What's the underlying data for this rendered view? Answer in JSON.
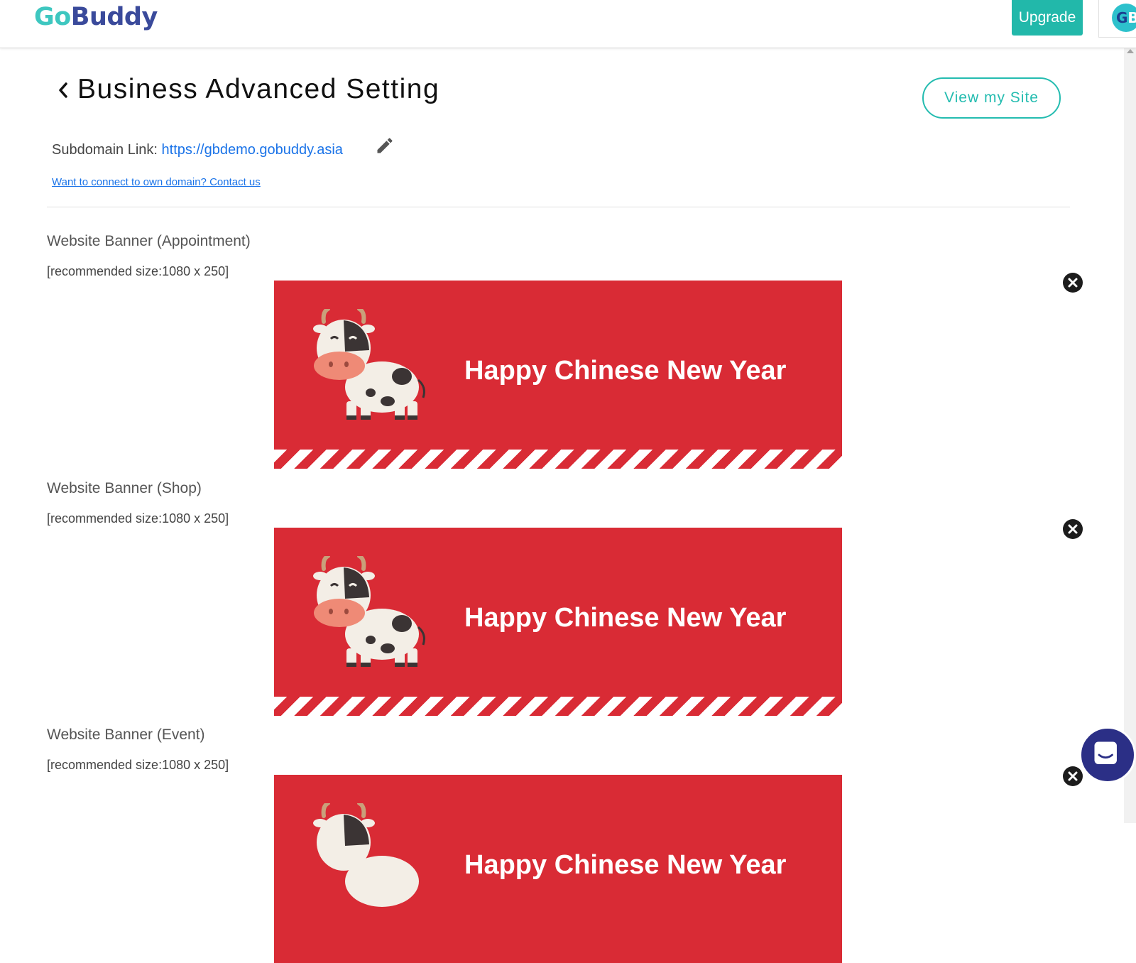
{
  "header": {
    "logo_go": "Go",
    "logo_buddy": "Buddy",
    "upgrade_label": "Upgrade",
    "avatar_initials_1": "G",
    "avatar_initials_2": "B"
  },
  "page": {
    "title": "Business Advanced Setting",
    "view_site_label": "View my Site",
    "subdomain_label": "Subdomain Link: ",
    "subdomain_url": "https://gbdemo.gobuddy.asia",
    "connect_domain_link": "Want to connect to own domain? Contact us"
  },
  "banners": [
    {
      "label": "Website Banner (Appointment)",
      "size_hint": "[recommended size:1080 x 250]",
      "banner_text": "Happy Chinese New Year"
    },
    {
      "label": "Website Banner (Shop)",
      "size_hint": "[recommended size:1080 x 250]",
      "banner_text": "Happy Chinese New Year"
    },
    {
      "label": "Website Banner (Event)",
      "size_hint": "[recommended size:1080 x 250]",
      "banner_text": "Happy Chinese New Year"
    }
  ],
  "icons": {
    "back": "chevron-left-icon",
    "edit": "pencil-icon",
    "remove": "close-circle-icon",
    "chat": "chat-icon"
  },
  "colors": {
    "brand_teal": "#22b8aa",
    "brand_navy": "#3a4a9b",
    "banner_red": "#d92b35",
    "link_blue": "#1a73e8",
    "chat_bubble": "#2b2f86"
  }
}
